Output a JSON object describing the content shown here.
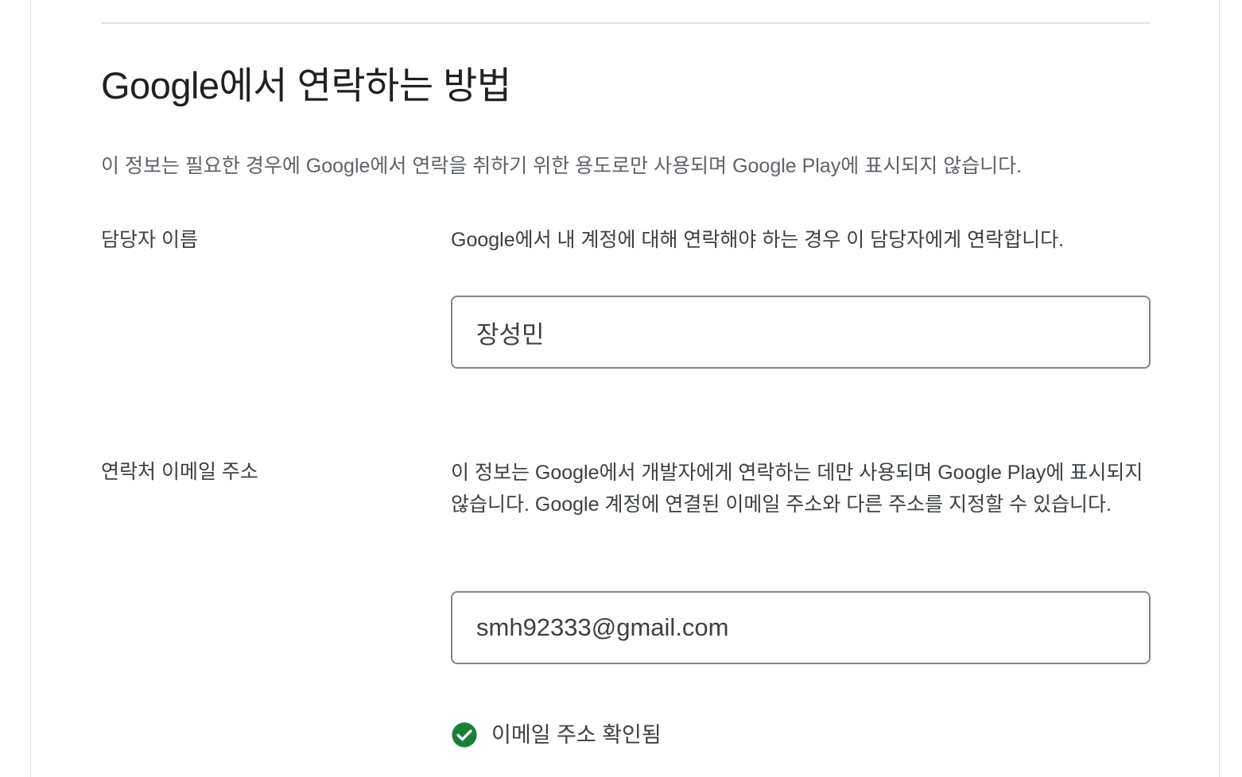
{
  "section": {
    "title": "Google에서 연락하는 방법",
    "description": "이 정보는 필요한 경우에 Google에서 연락을 취하기 위한 용도로만 사용되며 Google Play에 표시되지 않습니다."
  },
  "contact_name": {
    "label": "담당자 이름",
    "help": "Google에서 내 계정에 대해 연락해야 하는 경우 이 담당자에게 연락합니다.",
    "value": "장성민"
  },
  "contact_email": {
    "label": "연락처 이메일 주소",
    "help": "이 정보는 Google에서 개발자에게 연락하는 데만 사용되며 Google Play에 표시되지 않습니다. Google 계정에 연결된 이메일 주소와 다른 주소를 지정할 수 있습니다.",
    "value": "smh92333@gmail.com",
    "status": {
      "text": "이메일 주소 확인됨",
      "icon": "check-circle-icon",
      "color": "#188038"
    }
  },
  "colors": {
    "text_primary": "#202124",
    "text_secondary": "#5f6368",
    "field_border": "#80868b",
    "divider": "#e3e3e3"
  }
}
